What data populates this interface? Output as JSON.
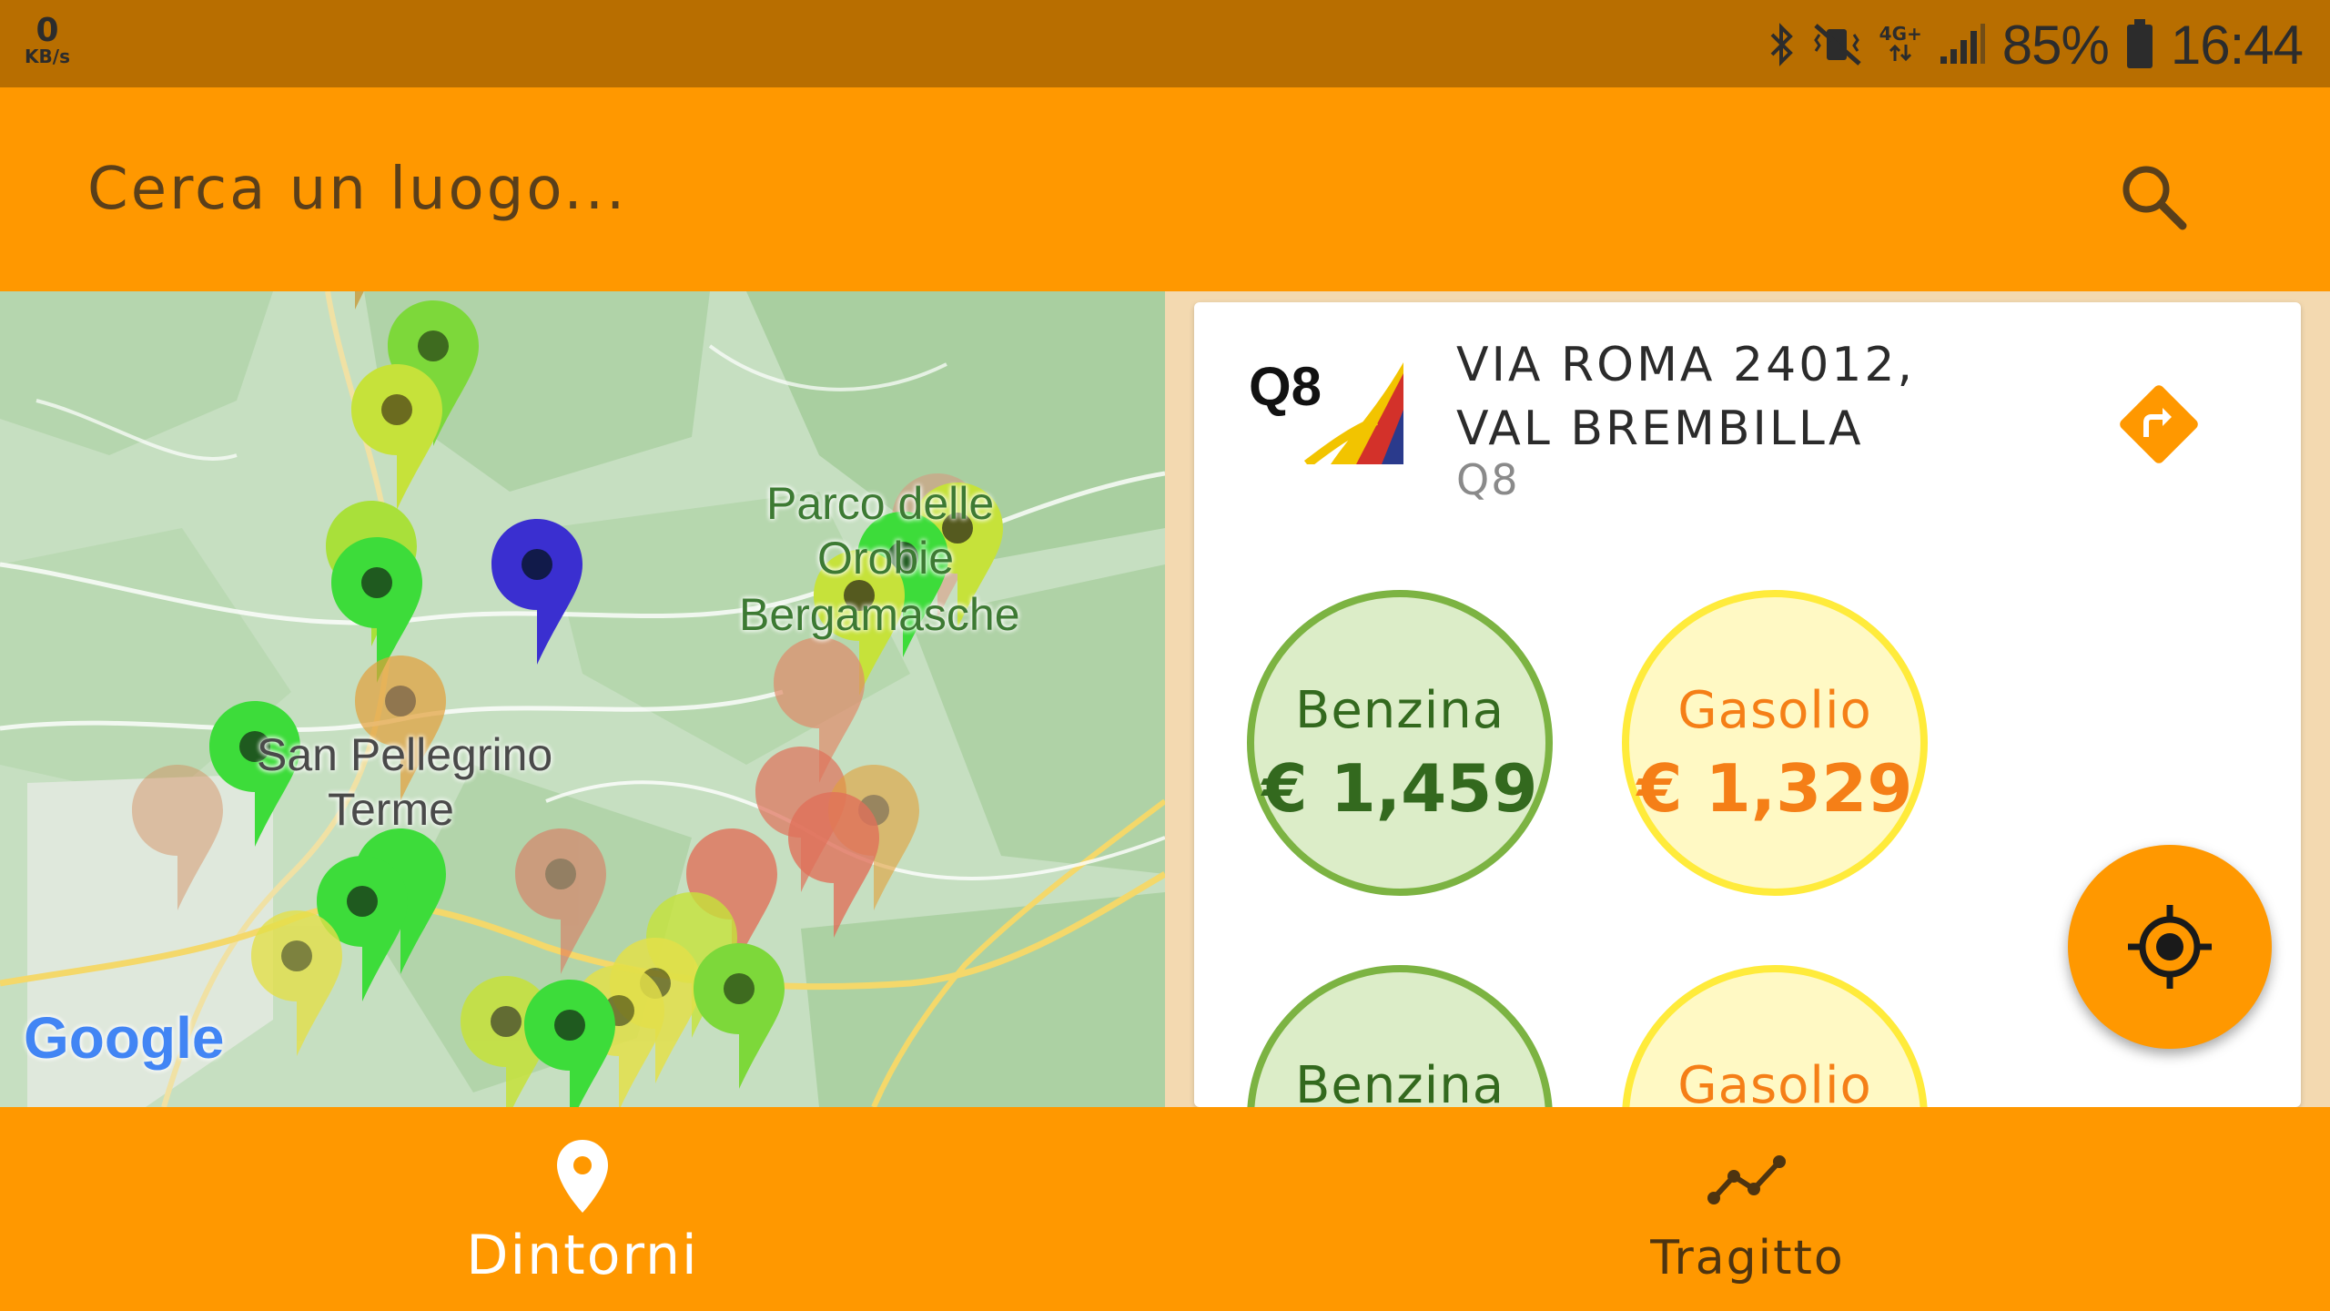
{
  "status_bar": {
    "net_speed_value": "0",
    "net_speed_unit": "KB/s",
    "network_type": "4G+",
    "battery": "85%",
    "time": "16:44",
    "icons": [
      "bluetooth-icon",
      "vibrate-mute-icon",
      "data-arrows-icon",
      "signal-icon",
      "battery-icon"
    ]
  },
  "search": {
    "placeholder": "Cerca un luogo...",
    "icon": "search-icon"
  },
  "map": {
    "labels": [
      "Parco delle",
      "Orobie",
      "Bergamasche",
      "San Pellegrino",
      "Terme"
    ],
    "attribution": "Google",
    "colors": {
      "green": "#4caf50",
      "bright_green": "#3ddc3a",
      "yellow_green": "#c6e23a",
      "yellow": "#e3e04a",
      "orange": "#e3a03a",
      "red": "#e0705a",
      "selected": "#3a2fd0"
    }
  },
  "station": {
    "address_line1": "VIA ROMA  24012,",
    "address_line2": "VAL BREMBILLA",
    "brand": "Q8",
    "logo_text": "Q8",
    "directions_icon": "directions-icon",
    "prices": [
      {
        "fuel": "Benzina",
        "price": "€ 1,459",
        "color": "green"
      },
      {
        "fuel": "Gasolio",
        "price": "€ 1,329",
        "color": "yellow"
      },
      {
        "fuel": "Benzina",
        "price": "",
        "color": "green"
      },
      {
        "fuel": "Gasolio",
        "price": "",
        "color": "yellow"
      }
    ]
  },
  "fab": {
    "icon": "my-location-icon"
  },
  "bottom_nav": {
    "items": [
      {
        "label": "Dintorni",
        "icon": "location-pin-icon",
        "active": true
      },
      {
        "label": "Tragitto",
        "icon": "route-icon",
        "active": false
      }
    ]
  },
  "theme": {
    "primary": "#ff9800",
    "status_bar": "#b86e00",
    "accent_green": "#7cb342",
    "accent_yellow": "#ffeb3b"
  }
}
